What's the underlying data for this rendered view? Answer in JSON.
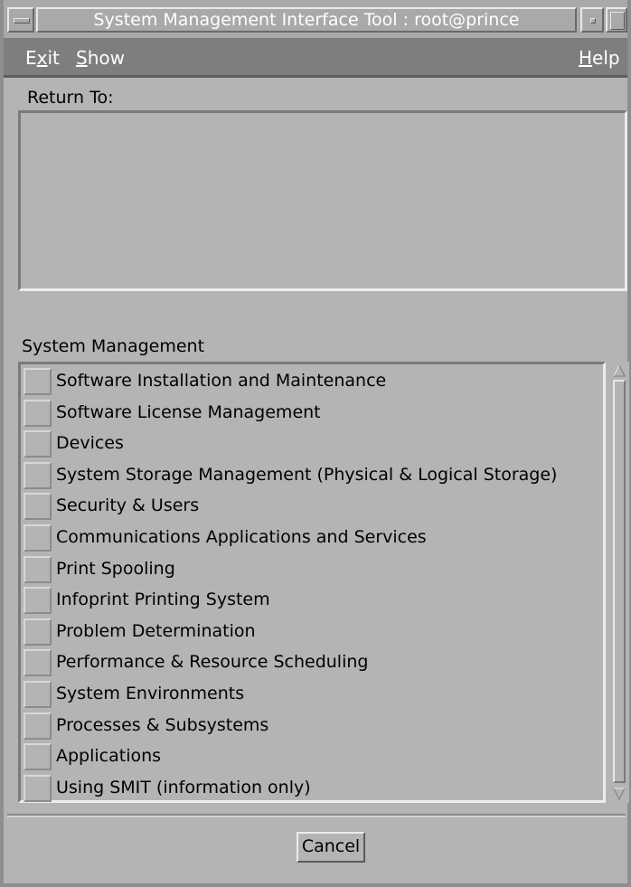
{
  "window": {
    "title": "System Management Interface Tool : root@prince"
  },
  "menubar": {
    "exit_pre": "E",
    "exit_mn": "x",
    "exit_post": "it",
    "show_mn": "S",
    "show_post": "how",
    "help_mn": "H",
    "help_post": "elp"
  },
  "return_to": {
    "label": "Return To:"
  },
  "system_management": {
    "label": "System Management",
    "items": [
      {
        "label": "Software Installation and Maintenance"
      },
      {
        "label": "Software License Management"
      },
      {
        "label": "Devices"
      },
      {
        "label": "System Storage Management (Physical & Logical Storage)"
      },
      {
        "label": "Security & Users"
      },
      {
        "label": "Communications Applications and Services"
      },
      {
        "label": "Print Spooling"
      },
      {
        "label": "Infoprint Printing System"
      },
      {
        "label": "Problem Determination"
      },
      {
        "label": "Performance & Resource Scheduling"
      },
      {
        "label": "System Environments"
      },
      {
        "label": "Processes & Subsystems"
      },
      {
        "label": "Applications"
      },
      {
        "label": "Using SMIT (information only)"
      }
    ]
  },
  "footer": {
    "cancel_label": "Cancel"
  },
  "icons": {
    "window_menu": "window-menu-icon",
    "minimize": "minimize-icon",
    "maximize": "maximize-icon",
    "scroll_up": "scroll-up-arrow-icon",
    "scroll_down": "scroll-down-arrow-icon"
  },
  "colors": {
    "window_background": "#b4b4b4",
    "menubar_background": "#7e7e7e",
    "titlebar_background": "#a9a9a9"
  }
}
